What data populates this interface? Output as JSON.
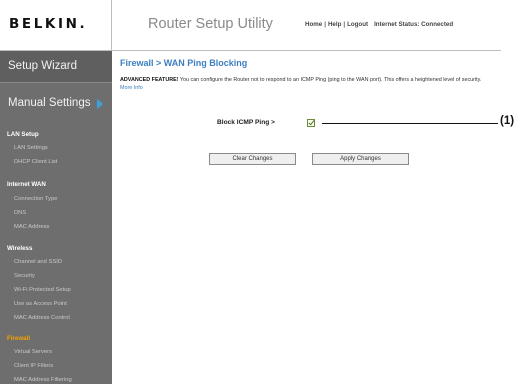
{
  "header": {
    "logo": "BELKIN.",
    "app_title": "Router Setup Utility",
    "links": [
      "Home",
      "Help",
      "Logout"
    ],
    "link_separator": "|",
    "status": "Internet Status: Connected"
  },
  "sidebar": {
    "setup_wizard": "Setup Wizard",
    "manual_settings": "Manual Settings",
    "sections": [
      {
        "title": "LAN Setup",
        "items": [
          "LAN Settings",
          "DHCP Client List"
        ]
      },
      {
        "title": "Internet WAN",
        "items": [
          "Connection Type",
          "DNS",
          "MAC Address"
        ]
      },
      {
        "title": "Wireless",
        "items": [
          "Channel and SSID",
          "Security",
          "Wi-Fi Protected Setup",
          "Use as Access Point",
          "MAC Address Control"
        ]
      },
      {
        "title": "Firewall",
        "items": [
          "Virtual Servers",
          "Client IP Filters",
          "MAC Address Filtering"
        ]
      }
    ]
  },
  "main": {
    "title": "Firewall > WAN Ping Blocking",
    "desc_bold": "ADVANCED FEATURE!",
    "desc_text": " You can configure the Router not to respond to an ICMP Ping (ping to the WAN port). This offers a heightened level of security. ",
    "more_info": "More Info",
    "block_label": "Block ICMP Ping >",
    "block_checked": true,
    "clear_button": "Clear Changes",
    "apply_button": "Apply Changes"
  },
  "callout": "(1)",
  "colors": {
    "sidebar_bg": "#6e6e6e",
    "firewall_section": "#f4a000",
    "title_blue": "#3d7fc0"
  }
}
